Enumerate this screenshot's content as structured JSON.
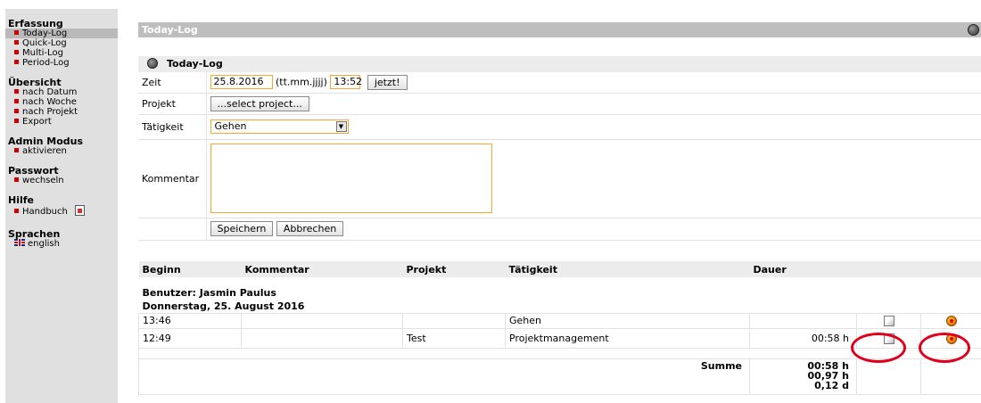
{
  "sidebar": {
    "sections": [
      {
        "heading": "Erfassung",
        "items": [
          "Today-Log",
          "Quick-Log",
          "Multi-Log",
          "Period-Log"
        ]
      },
      {
        "heading": "Übersicht",
        "items": [
          "nach Datum",
          "nach Woche",
          "nach Projekt",
          "Export"
        ]
      },
      {
        "heading": "Admin Modus",
        "items": [
          "aktivieren"
        ]
      },
      {
        "heading": "Passwort",
        "items": [
          "wechseln"
        ]
      },
      {
        "heading": "Hilfe",
        "items": [
          "Handbuch"
        ]
      },
      {
        "heading": "Sprachen",
        "items": [
          "english"
        ]
      }
    ]
  },
  "topbar": {
    "title": "Today-Log"
  },
  "form": {
    "title": "Today-Log",
    "zeit_label": "Zeit",
    "date_value": "25.8.2016",
    "date_hint": "(tt.mm.jjjj)",
    "time_value": "13:52",
    "now_button": "jetzt!",
    "projekt_label": "Projekt",
    "select_project_button": "...select project...",
    "taetigkeit_label": "Tätigkeit",
    "taetigkeit_value": "Gehen",
    "kommentar_label": "Kommentar",
    "kommentar_value": "",
    "save_button": "Speichern",
    "cancel_button": "Abbrechen"
  },
  "log": {
    "headers": [
      "Beginn",
      "Kommentar",
      "Projekt",
      "Tätigkeit",
      "Dauer"
    ],
    "user_line": "Benutzer: Jasmin Paulus",
    "date_line": "Donnerstag, 25. August 2016",
    "rows": [
      {
        "beginn": "13:46",
        "kommentar": "",
        "projekt": "",
        "taetigkeit": "Gehen",
        "dauer": ""
      },
      {
        "beginn": "12:49",
        "kommentar": "",
        "projekt": "Test",
        "taetigkeit": "Projektmanagement",
        "dauer": "00:58 h"
      }
    ],
    "summe_label": "Summe",
    "summe_values": [
      "00:58 h",
      "00,97 h",
      "0,12 d"
    ]
  },
  "colors": {
    "accent_red": "#e0001b",
    "sidebar_bg": "#e0e0e0",
    "topbar_bg": "#bebebe",
    "input_border": "#f2a832"
  }
}
